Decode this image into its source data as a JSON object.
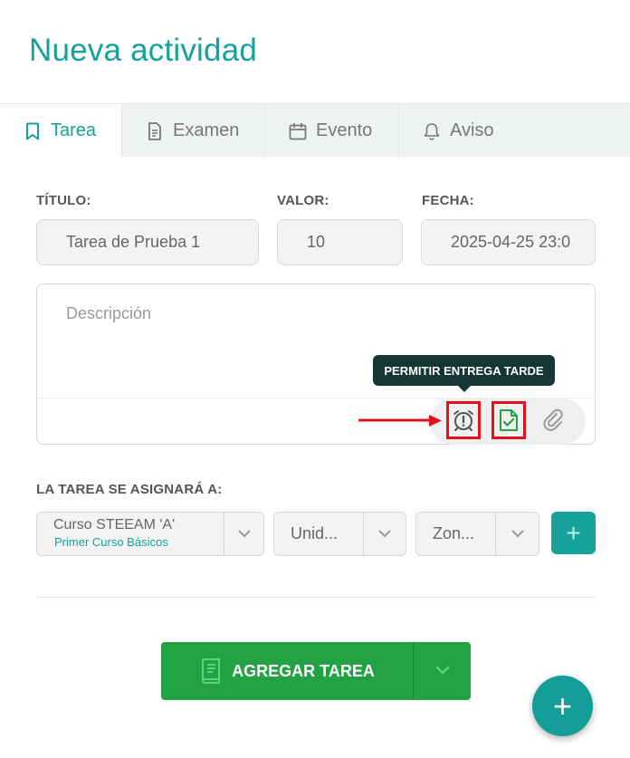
{
  "page": {
    "title": "Nueva actividad"
  },
  "tabs": [
    {
      "label": "Tarea",
      "icon": "bookmark-icon",
      "active": true
    },
    {
      "label": "Examen",
      "icon": "document-icon"
    },
    {
      "label": "Evento",
      "icon": "calendar-icon"
    },
    {
      "label": "Aviso",
      "icon": "bell-icon"
    }
  ],
  "form": {
    "titulo": {
      "label": "TÍTULO:",
      "value": "Tarea de Prueba 1"
    },
    "valor": {
      "label": "VALOR:",
      "value": "10"
    },
    "fecha": {
      "label": "FECHA:",
      "value": "2025-04-25 23:0"
    },
    "descripcion": {
      "placeholder": "Descripción"
    }
  },
  "toolbar": {
    "tooltip": "PERMITIR ENTREGA TARDE",
    "icons": [
      "alarm-late-icon",
      "file-check-icon",
      "paperclip-icon"
    ]
  },
  "assign": {
    "label": "LA TAREA SE ASIGNARÁ A:",
    "curso": {
      "value": "Curso STEEAM 'A'",
      "sub": "Primer Curso Básicos"
    },
    "unidad": {
      "value": "Unid..."
    },
    "zona": {
      "value": "Zon..."
    },
    "add_label": "+"
  },
  "actions": {
    "add_task_label": "AGREGAR TAREA",
    "fab_label": "+"
  },
  "colors": {
    "accent": "#14a29a",
    "primary_button": "#22a242",
    "tooltip_bg": "#143736",
    "highlight": "#e3101a"
  }
}
